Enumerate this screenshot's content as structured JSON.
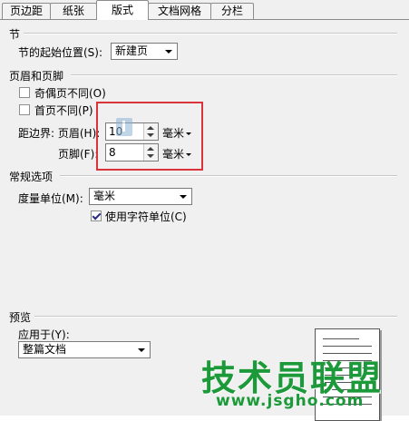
{
  "tabs": [
    {
      "label": "页边距",
      "active": false
    },
    {
      "label": "纸张",
      "active": false
    },
    {
      "label": "版式",
      "active": true
    },
    {
      "label": "文档网格",
      "active": false
    },
    {
      "label": "分栏",
      "active": false
    }
  ],
  "section": {
    "title": "节",
    "start_label": "节的起始位置(S):",
    "start_value": "新建页"
  },
  "header_footer": {
    "title": "页眉和页脚",
    "odd_even_label": "奇偶页不同(O)",
    "odd_even_checked": false,
    "first_page_label": "首页不同(P)",
    "first_page_checked": false,
    "distance_label": "距边界: 页眉(H):",
    "header_value": "10",
    "header_unit": "毫米",
    "footer_label": "页脚(F):",
    "footer_value": "8",
    "footer_unit": "毫米"
  },
  "general": {
    "title": "常规选项",
    "measure_label": "度量单位(M):",
    "measure_value": "毫米",
    "char_unit_label": "使用字符单位(C)",
    "char_unit_checked": true
  },
  "preview": {
    "title": "预览",
    "apply_label": "应用于(Y):",
    "apply_value": "整篇文档"
  },
  "watermark": {
    "text": "技术员联盟",
    "url": "www.jsgho.com"
  },
  "colors": {
    "highlight_box": "#d9343a",
    "watermark": "#1c9a3a"
  }
}
